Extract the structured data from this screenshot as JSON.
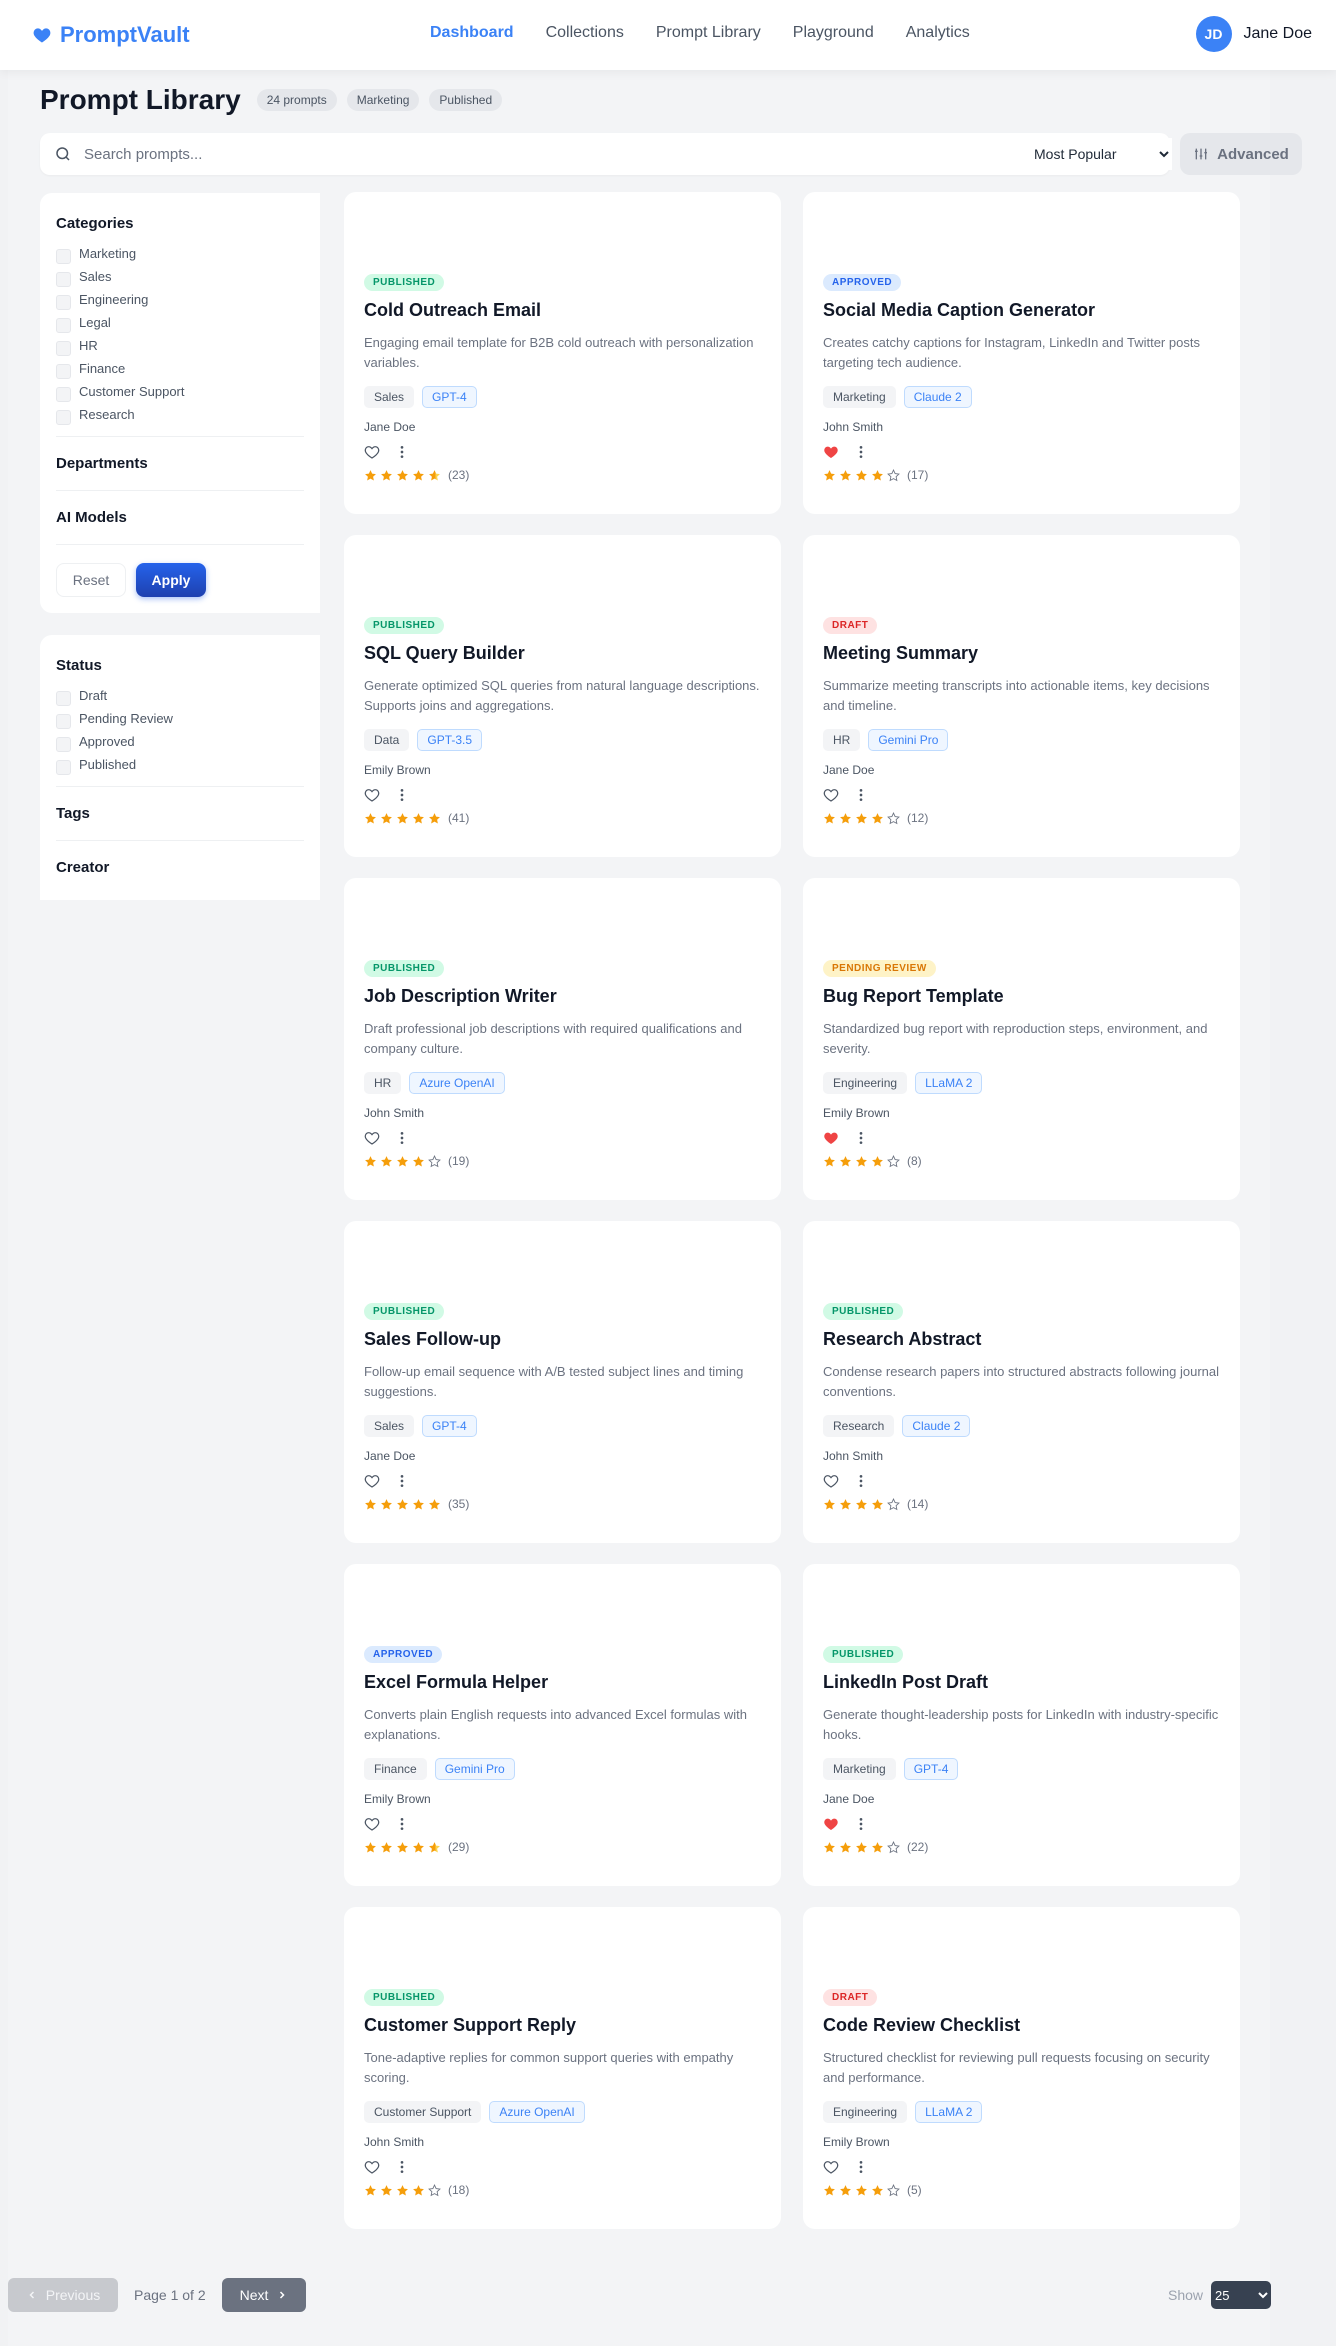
{
  "app": {
    "name": "PromptVault",
    "nav": [
      "Dashboard",
      "Collections",
      "Prompt Library",
      "Playground",
      "Analytics"
    ],
    "user": {
      "initials": "JD",
      "name": "Jane Doe"
    }
  },
  "page": {
    "title": "Prompt Library",
    "chips": [
      "24 prompts",
      "Marketing",
      "Published"
    ]
  },
  "search": {
    "placeholder": "Search prompts...",
    "sort_value": "Most Popular",
    "advanced_label": "Advanced"
  },
  "filters": {
    "categories_title": "Categories",
    "categories": [
      "Marketing",
      "Sales",
      "Engineering",
      "Legal",
      "HR",
      "Finance",
      "Customer Support",
      "Research"
    ],
    "departments_title": "Departments",
    "ai_models_title": "AI Models",
    "reset_label": "Reset",
    "apply_label": "Apply",
    "status_title": "Status",
    "statuses": [
      "Draft",
      "Pending Review",
      "Approved",
      "Published"
    ],
    "tags_title": "Tags",
    "creator_title": "Creator"
  },
  "cards": [
    {
      "status": "PUBLISHED",
      "status_kind": "published",
      "title": "Cold Outreach Email",
      "desc": "Engaging email template for B2B cold outreach with personalization variables.",
      "category": "Sales",
      "model": "GPT-4",
      "author": "Jane Doe",
      "favorited": false,
      "rating": 4.5,
      "count": "(23)"
    },
    {
      "status": "APPROVED",
      "status_kind": "approved",
      "title": "Social Media Caption Generator",
      "desc": "Creates catchy captions for Instagram, LinkedIn and Twitter posts targeting tech audience.",
      "category": "Marketing",
      "model": "Claude 2",
      "author": "John Smith",
      "favorited": true,
      "rating": 4,
      "count": "(17)"
    },
    {
      "status": "PUBLISHED",
      "status_kind": "published",
      "title": "SQL Query Builder",
      "desc": "Generate optimized SQL queries from natural language descriptions. Supports joins and aggregations.",
      "category": "Data",
      "model": "GPT-3.5",
      "author": "Emily Brown",
      "favorited": false,
      "rating": 5,
      "count": "(41)"
    },
    {
      "status": "DRAFT",
      "status_kind": "draft",
      "title": "Meeting Summary",
      "desc": "Summarize meeting transcripts into actionable items, key decisions and timeline.",
      "category": "HR",
      "model": "Gemini Pro",
      "author": "Jane Doe",
      "favorited": false,
      "rating": 4,
      "count": "(12)"
    },
    {
      "status": "PUBLISHED",
      "status_kind": "published",
      "title": "Job Description Writer",
      "desc": "Draft professional job descriptions with required qualifications and company culture.",
      "category": "HR",
      "model": "Azure OpenAI",
      "author": "John Smith",
      "favorited": false,
      "rating": 4,
      "count": "(19)"
    },
    {
      "status": "PENDING REVIEW",
      "status_kind": "pending",
      "title": "Bug Report Template",
      "desc": "Standardized bug report with reproduction steps, environment, and severity.",
      "category": "Engineering",
      "model": "LLaMA 2",
      "author": "Emily Brown",
      "favorited": true,
      "rating": 4,
      "count": "(8)"
    },
    {
      "status": "PUBLISHED",
      "status_kind": "published",
      "title": "Sales Follow-up",
      "desc": "Follow-up email sequence with A/B tested subject lines and timing suggestions.",
      "category": "Sales",
      "model": "GPT-4",
      "author": "Jane Doe",
      "favorited": false,
      "rating": 5,
      "count": "(35)"
    },
    {
      "status": "PUBLISHED",
      "status_kind": "published",
      "title": "Research Abstract",
      "desc": "Condense research papers into structured abstracts following journal conventions.",
      "category": "Research",
      "model": "Claude 2",
      "author": "John Smith",
      "favorited": false,
      "rating": 4,
      "count": "(14)"
    },
    {
      "status": "APPROVED",
      "status_kind": "approved",
      "title": "Excel Formula Helper",
      "desc": "Converts plain English requests into advanced Excel formulas with explanations.",
      "category": "Finance",
      "model": "Gemini Pro",
      "author": "Emily Brown",
      "favorited": false,
      "rating": 4.5,
      "count": "(29)"
    },
    {
      "status": "PUBLISHED",
      "status_kind": "published",
      "title": "LinkedIn Post Draft",
      "desc": "Generate thought-leadership posts for LinkedIn with industry-specific hooks.",
      "category": "Marketing",
      "model": "GPT-4",
      "author": "Jane Doe",
      "favorited": true,
      "rating": 4,
      "count": "(22)"
    },
    {
      "status": "PUBLISHED",
      "status_kind": "published",
      "title": "Customer Support Reply",
      "desc": "Tone-adaptive replies for common support queries with empathy scoring.",
      "category": "Customer Support",
      "model": "Azure OpenAI",
      "author": "John Smith",
      "favorited": false,
      "rating": 4,
      "count": "(18)"
    },
    {
      "status": "DRAFT",
      "status_kind": "draft",
      "title": "Code Review Checklist",
      "desc": "Structured checklist for reviewing pull requests focusing on security and performance.",
      "category": "Engineering",
      "model": "LLaMA 2",
      "author": "Emily Brown",
      "favorited": false,
      "rating": 4,
      "count": "(5)"
    }
  ],
  "pagination": {
    "prev_label": "Previous",
    "page_info": "Page 1 of 2",
    "next_label": "Next",
    "show_label": "Show",
    "page_size": "25"
  },
  "colors": {
    "accent": "#3b82f6",
    "star": "#f59e0b",
    "heart": "#ef4444"
  }
}
